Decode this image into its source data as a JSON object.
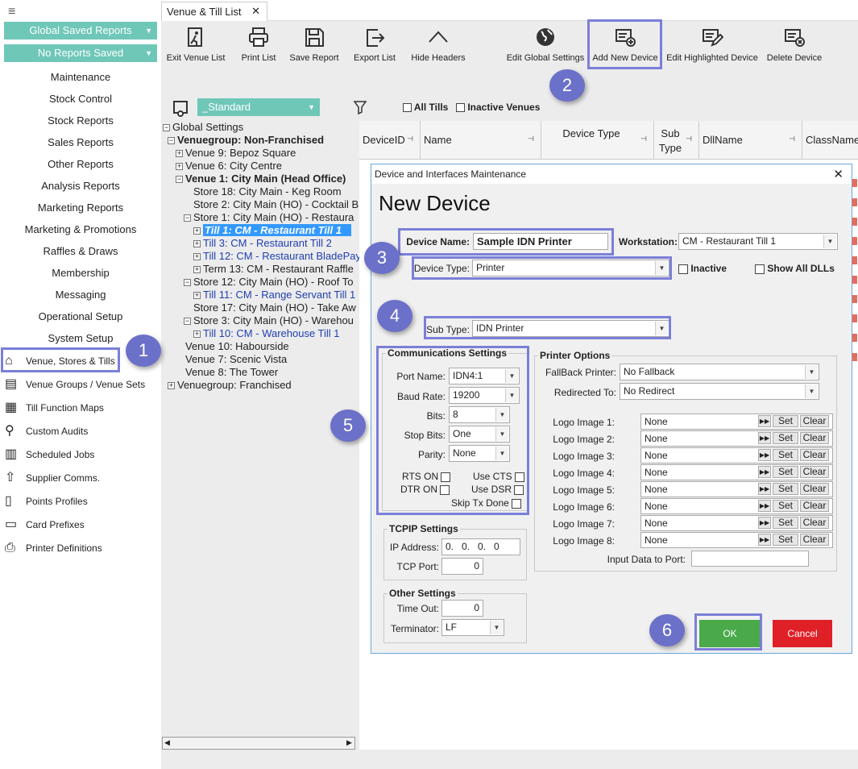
{
  "nav": {
    "menu_icon": "hamburger-icon",
    "saved_reports": "Global Saved Reports",
    "no_reports": "No Reports Saved",
    "sections": [
      "Maintenance",
      "Stock Control",
      "Stock Reports",
      "Sales Reports",
      "Other Reports",
      "Analysis Reports",
      "Marketing Reports",
      "Marketing & Promotions",
      "Raffles & Draws",
      "Membership",
      "Messaging",
      "Operational Setup",
      "System Setup"
    ],
    "icon_items": [
      {
        "label": "Venue, Stores & Tills",
        "icon": "venue-icon"
      },
      {
        "label": "Venue Groups / Venue Sets",
        "icon": "venue-groups-icon"
      },
      {
        "label": "Till Function Maps",
        "icon": "grid-icon"
      },
      {
        "label": "Custom Audits",
        "icon": "audit-icon"
      },
      {
        "label": "Scheduled Jobs",
        "icon": "calendar-icon"
      },
      {
        "label": "Supplier Comms.",
        "icon": "upload-icon"
      },
      {
        "label": "Points Profiles",
        "icon": "document-icon"
      },
      {
        "label": "Card Prefixes",
        "icon": "card-icon"
      },
      {
        "label": "Printer Definitions",
        "icon": "printer-icon"
      }
    ]
  },
  "tab": {
    "label": "Venue & Till List",
    "close": "✕"
  },
  "toolbar": {
    "exit": "Exit Venue List",
    "print": "Print List",
    "save": "Save Report",
    "export": "Export List",
    "hide": "Hide Headers",
    "edit_global": "Edit Global Settings",
    "add_device": "Add New Device",
    "edit_highlighted": "Edit Highlighted Device",
    "delete_device": "Delete Device"
  },
  "filter": {
    "view": "_Standard",
    "all_tills": "All Tills",
    "inactive_venues": "Inactive Venues"
  },
  "tree": [
    {
      "t": "Global Settings"
    },
    {
      "t": "Venuegroup: Non-Franchised"
    },
    {
      "t": "Venue 9: Bepoz Square"
    },
    {
      "t": "Venue 6: City Centre"
    },
    {
      "t": "Venue 1: City Main (Head Office)"
    },
    {
      "t": "Store 18: City Main - Keg Room"
    },
    {
      "t": "Store 2: City Main (HO) - Cocktail B"
    },
    {
      "t": "Store 1: City Main (HO) - Restaura"
    },
    {
      "t": "Till 1: CM - Restaurant Till 1"
    },
    {
      "t": "Till 3: CM - Restaurant Till 2"
    },
    {
      "t": "Till 12: CM - Restaurant BladePay"
    },
    {
      "t": "Term 13: CM - Restaurant Raffle"
    },
    {
      "t": "Store 12: City Main (HO) - Roof To"
    },
    {
      "t": "Till 11: CM - Range Servant Till 1"
    },
    {
      "t": "Store 17: City Main (HO) - Take Aw"
    },
    {
      "t": "Store 3: City Main (HO) - Warehou"
    },
    {
      "t": "Till 10: CM - Warehouse Till 1"
    },
    {
      "t": "Venue 10: Habourside"
    },
    {
      "t": "Venue 7: Scenic Vista"
    },
    {
      "t": "Venue 8: The Tower"
    },
    {
      "t": "Venuegroup: Franchised"
    }
  ],
  "grid": {
    "cols": [
      "DeviceID",
      "Name",
      "Device Type",
      "Sub Type",
      "DllName",
      "ClassName"
    ]
  },
  "dialog": {
    "title": "Device and Interfaces Maintenance",
    "heading": "New Device",
    "device_name_label": "Device Name:",
    "device_name": "Sample IDN Printer",
    "workstation_label": "Workstation:",
    "workstation": "CM - Restaurant Till 1",
    "device_type_label": "Device Type:",
    "device_type": "Printer",
    "inactive": "Inactive",
    "show_all_dlls": "Show All DLLs",
    "sub_type_label": "Sub Type:",
    "sub_type": "IDN Printer",
    "comm": {
      "title": "Communications Settings",
      "port_label": "Port Name:",
      "port": "IDN4:1",
      "baud_label": "Baud Rate:",
      "baud": "19200",
      "bits_label": "Bits:",
      "bits": "8",
      "stop_label": "Stop Bits:",
      "stop": "One",
      "parity_label": "Parity:",
      "parity": "None",
      "rts": "RTS ON",
      "cts": "Use CTS",
      "dtr": "DTR ON",
      "dsr": "Use DSR",
      "skip": "Skip Tx Done"
    },
    "tcpip": {
      "title": "TCPIP Settings",
      "ip_label": "IP Address:",
      "ip": "0.   0.   0.   0",
      "port_label": "TCP Port:",
      "port": "0"
    },
    "other": {
      "title": "Other Settings",
      "timeout_label": "Time Out:",
      "timeout": "0",
      "term_label": "Terminator:",
      "term": "LF"
    },
    "printer": {
      "title": "Printer Options",
      "fallback_label": "FallBack Printer:",
      "fallback": "No Fallback",
      "redirect_label": "Redirected To:",
      "redirect": "No Redirect",
      "logos": [
        {
          "label": "Logo Image 1:",
          "value": "None"
        },
        {
          "label": "Logo Image 2:",
          "value": "None"
        },
        {
          "label": "Logo Image 3:",
          "value": "None"
        },
        {
          "label": "Logo Image 4:",
          "value": "None"
        },
        {
          "label": "Logo Image 5:",
          "value": "None"
        },
        {
          "label": "Logo Image 6:",
          "value": "None"
        },
        {
          "label": "Logo Image 7:",
          "value": "None"
        },
        {
          "label": "Logo Image 8:",
          "value": "None"
        }
      ],
      "set": "Set",
      "clear": "Clear",
      "input_label": "Input Data to Port:"
    },
    "ok": "OK",
    "cancel": "Cancel"
  },
  "badges": [
    "1",
    "2",
    "3",
    "4",
    "5",
    "6"
  ],
  "colors": {
    "teal": "#6fc7b8",
    "ok": "#4aaa4a",
    "cancel": "#e02027",
    "highlight": "#7b7fd8",
    "badge": "#6b70c9",
    "tree_select": "#3399ff"
  }
}
